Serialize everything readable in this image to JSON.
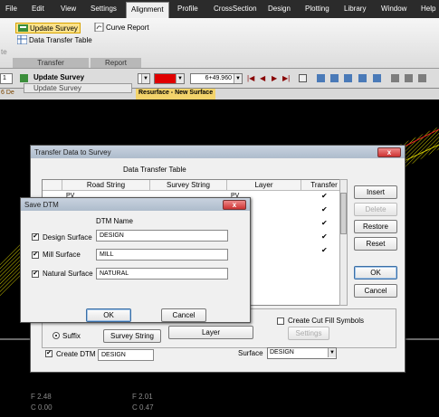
{
  "menu": [
    "File",
    "Edit",
    "View",
    "Settings",
    "Alignment",
    "Profile",
    "CrossSection",
    "Design",
    "Plotting",
    "Library",
    "Window",
    "Help"
  ],
  "ribbon": {
    "update_survey": "Update Survey",
    "data_transfer_table": "Data Transfer Table",
    "curve_report": "Curve Report",
    "group_transfer": "Transfer",
    "group_report": "Report",
    "left_edge": "te"
  },
  "toolbar": {
    "combo1": "1",
    "update_survey": "Update Survey",
    "update_survey_dropdown": "Update Survey",
    "station": "6+49.960",
    "design_fragment": "6 De"
  },
  "viewport": {
    "surface_banner": "Resurface - New Surface",
    "coords": [
      {
        "label": "F 2.48"
      },
      {
        "label": "C 0.00"
      },
      {
        "label": "F 2.01"
      },
      {
        "label": "C 0.47"
      }
    ]
  },
  "transfer_dialog": {
    "title": "Transfer Data to Survey",
    "heading": "Data Transfer Table",
    "columns": [
      "Road String",
      "Survey String",
      "Layer",
      "Transfer"
    ],
    "row1_road": "PV",
    "row1_layer": "PV",
    "checks": [
      "✔",
      "✔",
      "✔",
      "✔",
      "✔"
    ],
    "buttons": {
      "insert": "Insert",
      "delete": "Delete",
      "restore": "Restore",
      "reset": "Reset",
      "ok": "OK",
      "cancel": "Cancel"
    },
    "suffix_label": "Suffix",
    "survey_string_btn": "Survey String",
    "layer_btn": "Layer",
    "create_cut_fill": "Create Cut Fill Symbols",
    "settings_btn": "Settings",
    "create_dtm": "Create DTM",
    "create_dtm_value": "DESIGN",
    "surface_label": "Surface",
    "surface_value": "DESIGN"
  },
  "save_dtm": {
    "title": "Save DTM",
    "dtm_name_header": "DTM Name",
    "rows": [
      {
        "label": "Design Surface",
        "value": "DESIGN"
      },
      {
        "label": "Mill Surface",
        "value": "MILL"
      },
      {
        "label": "Natural Surface",
        "value": "NATURAL"
      }
    ],
    "ok": "OK",
    "cancel": "Cancel"
  }
}
